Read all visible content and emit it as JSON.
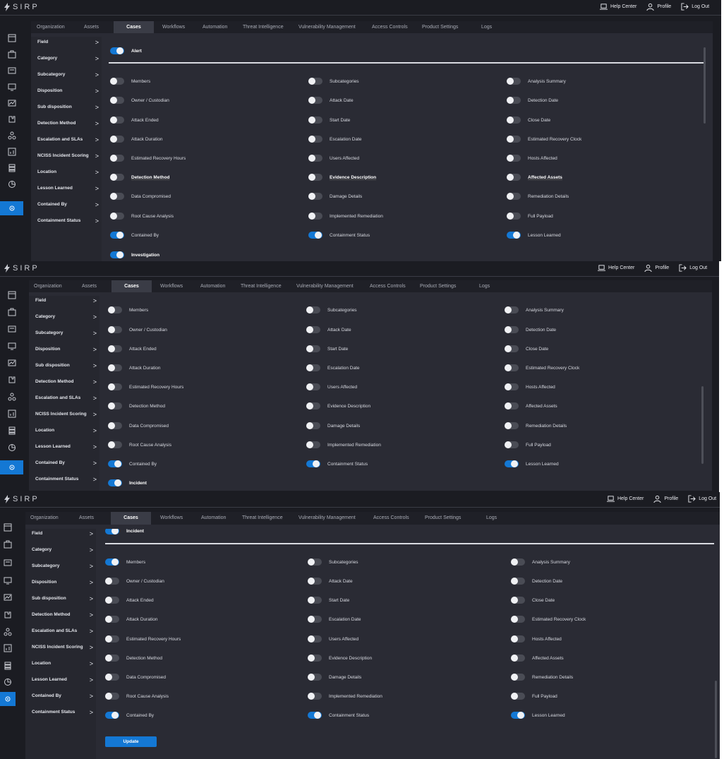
{
  "app": {
    "logo_text": "SIRP",
    "help_center": "Help Center",
    "profile": "Profile",
    "logout": "Log Out"
  },
  "tabs": [
    "Organization",
    "Assets",
    "Cases",
    "Workflows",
    "Automation",
    "Threat Intelligence",
    "Vulnerability Management",
    "Access Controls",
    "Product Settings",
    "Logs"
  ],
  "active_tab": "Cases",
  "field_list": [
    "Field",
    "Category",
    "Subcategory",
    "Disposition",
    "Sub disposition",
    "Detection Method",
    "Escalation and SLAs",
    "NCISS Incident Scoring",
    "Location",
    "Lesson Learned",
    "Contained By",
    "Containment Status"
  ],
  "sections": {
    "alert": "Alert",
    "investigation": "Investigation",
    "incident": "Incident"
  },
  "fields": [
    [
      "Members",
      "Subcategories",
      "Analysis Summary"
    ],
    [
      "Owner / Custodian",
      "Attack Date",
      "Detection Date"
    ],
    [
      "Attack Ended",
      "Start Date",
      "Close Date"
    ],
    [
      "Attack Duration",
      "Escalation Date",
      "Estimated Recovery Clock"
    ],
    [
      "Estimated Recovery Hours",
      "Users Affected",
      "Hosts Affected"
    ],
    [
      "Detection Method",
      "Evidence Description",
      "Affected Assets"
    ],
    [
      "Data Compromised",
      "Damage Details",
      "Remediation Details"
    ],
    [
      "Root Cause Analysis",
      "Implemented Remediation",
      "Full Payload"
    ],
    [
      "Contained By",
      "Containment Status",
      "Lesson Learned"
    ]
  ],
  "update_button": "Update",
  "colors": {
    "accent": "#1478d4",
    "background": "#1b1c22",
    "panel": "#2a2b34"
  }
}
